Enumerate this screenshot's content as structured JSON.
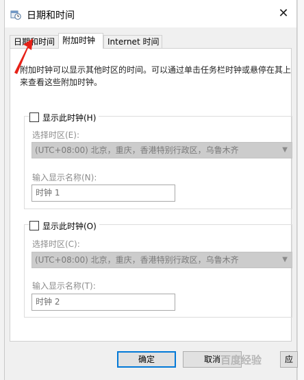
{
  "window": {
    "title": "日期和时间",
    "tabs": [
      {
        "label": "日期和时间",
        "active": false
      },
      {
        "label": "附加时钟",
        "active": true
      },
      {
        "label": "Internet 时间",
        "active": false
      }
    ]
  },
  "panel": {
    "description": "附加时钟可以显示其他时区的时间。可以通过单击任务栏时钟或悬停在其上来查看这些附加时钟。",
    "clock1": {
      "checkbox_label": "显示此时钟(H)",
      "checked": false,
      "timezone_label": "选择时区(E):",
      "timezone_value": "(UTC+08:00) 北京，重庆，香港特别行政区，乌鲁木齐",
      "name_label": "输入显示名称(N):",
      "name_value": "时钟 1"
    },
    "clock2": {
      "checkbox_label": "显示此时钟(O)",
      "checked": false,
      "timezone_label": "选择时区(C):",
      "timezone_value": "(UTC+08:00) 北京，重庆，香港特别行政区，乌鲁木齐",
      "name_label": "输入显示名称(T):",
      "name_value": "时钟 2"
    }
  },
  "buttons": {
    "ok": "确定",
    "cancel": "取消",
    "apply_partial": "应"
  },
  "watermark": "百度经验",
  "colors": {
    "accent": "#0078d7",
    "annotation_arrow": "#e62117",
    "disabled_text": "#8c8c8c"
  }
}
